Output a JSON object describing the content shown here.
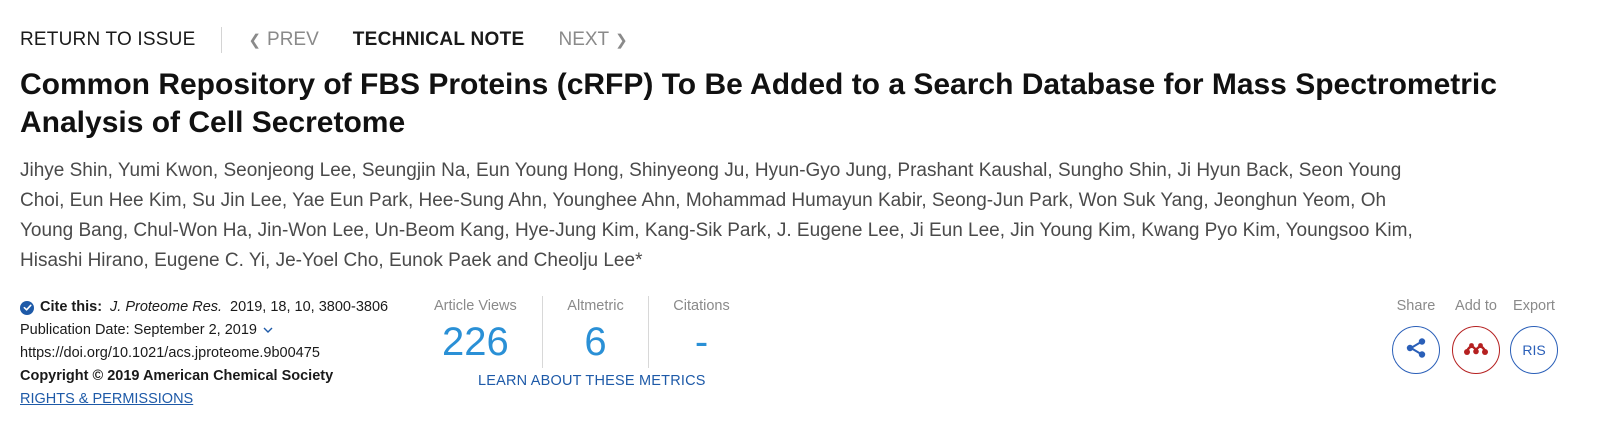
{
  "nav": {
    "return_label": "RETURN TO ISSUE",
    "prev_label": "PREV",
    "article_type": "TECHNICAL NOTE",
    "next_label": "NEXT"
  },
  "article": {
    "title": "Common Repository of FBS Proteins (cRFP) To Be Added to a Search Database for Mass Spectrometric Analysis of Cell Secretome",
    "authors": "Jihye Shin, Yumi Kwon, Seonjeong Lee, Seungjin Na, Eun Young Hong, Shinyeong Ju, Hyun-Gyo Jung, Prashant Kaushal, Sungho Shin, Ji Hyun Back, Seon Young Choi, Eun Hee Kim, Su Jin Lee, Yae Eun Park, Hee-Sung Ahn, Younghee Ahn, Mohammad Humayun Kabir, Seong-Jun Park, Won Suk Yang, Jeonghun Yeom, Oh Young Bang, Chul-Won Ha, Jin-Won Lee, Un-Beom Kang, Hye-Jung Kim, Kang-Sik Park, J. Eugene Lee, Ji Eun Lee, Jin Young Kim, Kwang Pyo Kim, Youngsoo Kim, Hisashi Hirano, Eugene C. Yi, Je-Yoel Cho, Eunok Paek and Cheolju Lee*"
  },
  "citation": {
    "label": "Cite this:",
    "journal": "J. Proteome Res.",
    "details": "2019, 18, 10, 3800-3806",
    "pub_date": "Publication Date: September 2, 2019",
    "doi": "https://doi.org/10.1021/acs.jproteome.9b00475",
    "copyright": "Copyright © 2019 American Chemical Society",
    "rights": "RIGHTS & PERMISSIONS"
  },
  "metrics": {
    "views_label": "Article Views",
    "views_value": "226",
    "altmetric_label": "Altmetric",
    "altmetric_value": "6",
    "citations_label": "Citations",
    "citations_value": "-",
    "learn_link": "LEARN ABOUT THESE METRICS"
  },
  "tools": {
    "share_label": "Share",
    "add_label": "Add to",
    "export_label": "Export",
    "export_button": "RIS"
  },
  "colors": {
    "accent_blue": "#2a90d6",
    "link_blue": "#1e5aa8",
    "mendeley_red": "#b52020"
  },
  "icons": [
    "chevron-left-icon",
    "chevron-right-icon",
    "check-circle-icon",
    "chevron-down-icon",
    "share-icon",
    "mendeley-icon"
  ]
}
